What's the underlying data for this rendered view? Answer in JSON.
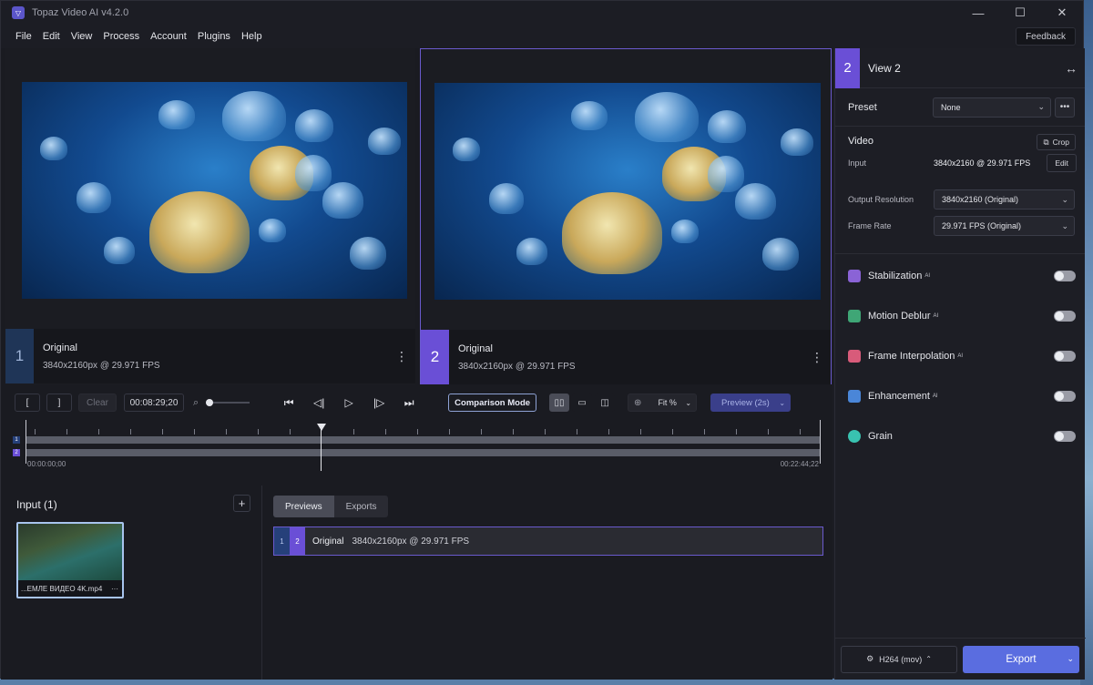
{
  "window": {
    "title": "Topaz Video AI  v4.2.0",
    "controls": [
      "—",
      "☐",
      "✕"
    ]
  },
  "menu": [
    "File",
    "Edit",
    "View",
    "Process",
    "Account",
    "Plugins",
    "Help"
  ],
  "feedback_label": "Feedback",
  "views": [
    {
      "num": "1",
      "name": "Original",
      "meta": "3840x2160px @ 29.971 FPS"
    },
    {
      "num": "2",
      "name": "Original",
      "meta": "3840x2160px @ 29.971 FPS"
    }
  ],
  "controls": {
    "in_mark": "[",
    "out_mark": "]",
    "clear_label": "Clear",
    "timecode": "00:08:29;20",
    "comparison_label": "Comparison Mode",
    "zoom_label": "Fit %",
    "preview_label": "Preview (2s)"
  },
  "timeline": {
    "start": "00:00:00;00",
    "end": "00:22:44;22",
    "tracks": [
      "1",
      "2"
    ]
  },
  "input_panel": {
    "title": "Input (1)",
    "add_label": "+",
    "file_name": "...ЕМЛЕ ВИДЕО 4K.mp4",
    "more": "···"
  },
  "previews": {
    "tabs": [
      "Previews",
      "Exports"
    ],
    "row": {
      "n1": "1",
      "n2": "2",
      "name": "Original",
      "meta": "3840x2160px @ 29.971 FPS"
    }
  },
  "right_panel": {
    "view_num": "2",
    "view_title": "View 2",
    "preset_label": "Preset",
    "preset_value": "None",
    "video_title": "Video",
    "crop_label": "Crop",
    "input_label": "Input",
    "input_value": "3840x2160 @ 29.971 FPS",
    "edit_label": "Edit",
    "output_label": "Output Resolution",
    "output_value": "3840x2160 (Original)",
    "framerate_label": "Frame Rate",
    "framerate_value": "29.971 FPS (Original)",
    "features": [
      {
        "label": "Stabilization",
        "ai": "AI",
        "color": "#8a63d6"
      },
      {
        "label": "Motion Deblur",
        "ai": "AI",
        "color": "#3fa676"
      },
      {
        "label": "Frame Interpolation",
        "ai": "AI",
        "color": "#d85b7a"
      },
      {
        "label": "Enhancement",
        "ai": "AI",
        "color": "#4a86d8"
      },
      {
        "label": "Grain",
        "ai": "",
        "color": "#39c2b0"
      }
    ],
    "codec_label": "H264 (mov)",
    "export_label": "Export"
  }
}
